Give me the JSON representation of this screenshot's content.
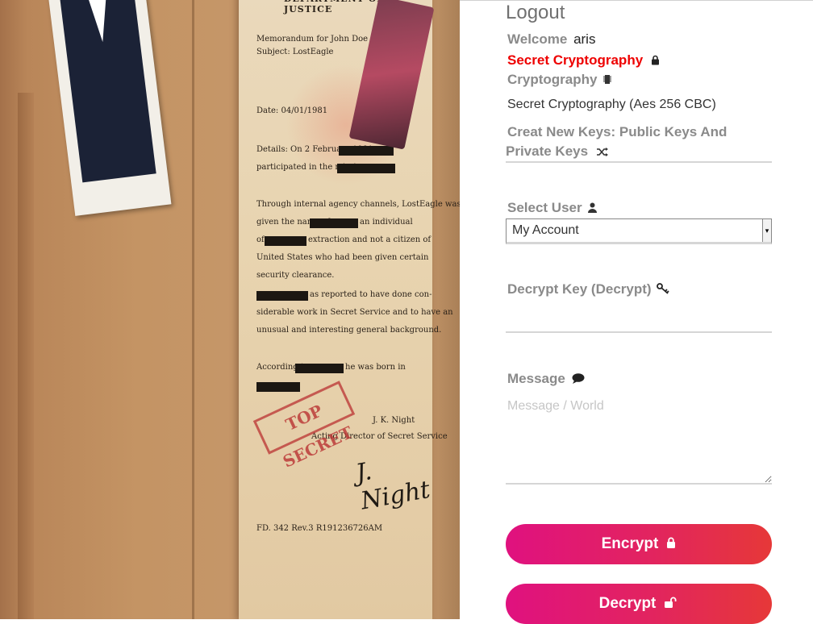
{
  "nav": {
    "logout": "Logout",
    "welcome_label": "Welcome",
    "username": "aris",
    "secret_crypto_link": "Secret Cryptography",
    "crypto_link": "Cryptography",
    "algorithm_text": "Secret Cryptography (Aes 256 CBC)",
    "create_keys_link": "Creat New Keys: Public Keys And Private Keys"
  },
  "form": {
    "select_user_label": "Select User",
    "select_user_value": "My Account",
    "decrypt_key_label": "Decrypt Key (Decrypt)",
    "decrypt_key_value": "",
    "message_label": "Message",
    "message_placeholder": "Message / World",
    "encrypt_button": "Encrypt",
    "decrypt_button": "Decrypt"
  },
  "document": {
    "header": "DEPARTMENT OF JUSTICE",
    "lines": [
      "Memorandum for John Doe",
      "Subject: LostEagle",
      "Date: 04/01/1981",
      "Details: On 2 February 1981,",
      "participated in the mission",
      "Through internal agency channels, LostEagle was",
      "given the name of",
      "an individual",
      "of",
      "extraction and not a citizen of",
      "United States who had been given certain",
      "security clearance.",
      "as reported to have done con-",
      "siderable work in Secret Service and to have an",
      "unusual and interesting general background.",
      "According to",
      "he was born in",
      "J. K. Night",
      "Acting Director of Secret Service",
      "FD. 342 Rev.3 R191236726AM"
    ],
    "stamp": "TOP SECRET",
    "signature": "J. Night"
  },
  "colors": {
    "accent_red": "#ee0000",
    "label_grey": "#8a8a8a",
    "button_gradient_start": "#e0117f",
    "button_gradient_end": "#e63838"
  },
  "icons": {
    "secret": "lock-icon",
    "crypto": "chip-icon",
    "keys": "shuffle-icon",
    "user": "user-icon",
    "key": "key-icon",
    "message": "chat-bubble-icon",
    "encrypt": "lock-icon",
    "decrypt": "unlock-icon"
  }
}
